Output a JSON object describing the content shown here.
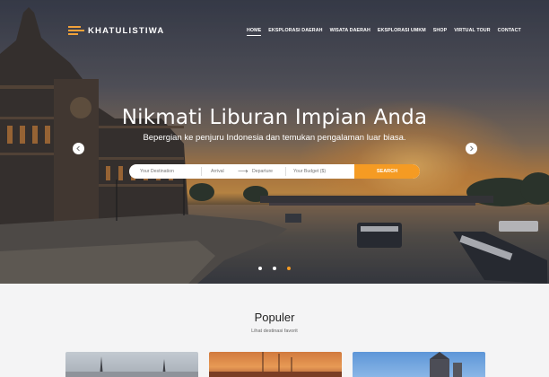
{
  "brand": {
    "name": "KHATULISTIWA",
    "logo_color": "#f2a23a"
  },
  "nav": {
    "items": [
      {
        "label": "HOME",
        "active": true
      },
      {
        "label": "EKSPLORASI DAERAH"
      },
      {
        "label": "WISATA DAERAH"
      },
      {
        "label": "EKSPLORASI UMKM"
      },
      {
        "label": "SHOP"
      },
      {
        "label": "VIRTUAL TOUR"
      },
      {
        "label": "CONTACT"
      }
    ]
  },
  "hero": {
    "title": "Nikmati Liburan Impian Anda",
    "subtitle": "Bepergian ke penjuru Indonesia dan temukan pengalaman luar biasa.",
    "prev_icon": "chevron-left-icon",
    "next_icon": "chevron-right-icon",
    "slides": {
      "count": 3,
      "active": 3
    }
  },
  "search": {
    "destination_placeholder": "Your Destination",
    "arrival_placeholder": "Arrival",
    "arrow_glyph": "⟶",
    "departure_placeholder": "Departure",
    "budget_placeholder": "Your Budget ($)",
    "button_label": "SEARCH",
    "accent_color": "#f59b23"
  },
  "populer": {
    "title": "Populer",
    "subtitle": "Lihat destinasi favorit"
  }
}
